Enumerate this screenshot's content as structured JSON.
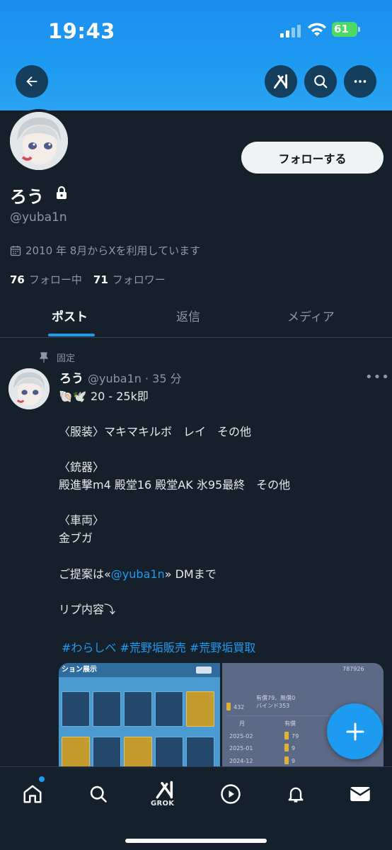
{
  "status_bar": {
    "time": "19:43",
    "battery": "61"
  },
  "header": {
    "back_icon": "arrow-left-icon",
    "grok_icon": "grok-icon",
    "search_icon": "search-icon",
    "more_icon": "more-horizontal-icon"
  },
  "profile": {
    "name": "ろう",
    "handle": "@yuba1n",
    "joined": "2010 年 8月からXを利用しています",
    "following_count": "76",
    "following_label": "フォロー中",
    "followers_count": "71",
    "followers_label": "フォロワー",
    "follow_button": "フォローする",
    "protected": true
  },
  "tabs": [
    {
      "label": "ポスト",
      "active": true
    },
    {
      "label": "返信",
      "active": false
    },
    {
      "label": "メディア",
      "active": false
    }
  ],
  "post": {
    "pinned_label": "固定",
    "author": "ろう",
    "meta": "@yuba1n · 35 分",
    "emoji": "🐚🕊️",
    "line1": "20 - 25k即",
    "section1": "〈服装〉マキマキルボ　レイ　その他",
    "section2_title": "〈銃器〉",
    "section2": "殿進撃m4 殿堂16 殿堂AK 氷95最終　その他",
    "section3_title": "〈車両〉",
    "section3": "金ブガ",
    "proposal_prefix": "ご提案は«",
    "proposal_mention": "@yuba1n",
    "proposal_suffix": "» DMまで",
    "reply_note": "リプ内容⤵︎",
    "hashtags": "#わらしべ #荒野垢販売 #荒野垢買取"
  },
  "media": {
    "image1_title": "ション展示",
    "image2_header": "有償79、無償0",
    "image2_sub": "バインド353",
    "image2_balance": "432",
    "image2_top": "787926",
    "image2_col_month": "月",
    "image2_col_paid": "有償",
    "image2_rows": [
      {
        "month": "2025-02",
        "value": "79"
      },
      {
        "month": "2025-01",
        "value": "9"
      },
      {
        "month": "2024-12",
        "value": "9"
      }
    ]
  },
  "bottom_nav": {
    "items": [
      "home-icon",
      "search-icon",
      "grok-icon",
      "play-icon",
      "bell-icon",
      "mail-icon"
    ],
    "grok_label": "GROK"
  },
  "colors": {
    "accent": "#1d9bf0",
    "background": "#15202b"
  }
}
